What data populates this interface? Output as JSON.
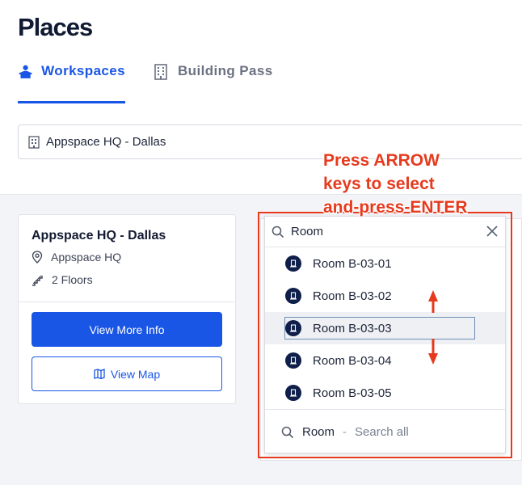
{
  "page": {
    "title": "Places"
  },
  "tabs": [
    {
      "label": "Workspaces",
      "icon": "person-desk-icon",
      "active": true
    },
    {
      "label": "Building Pass",
      "icon": "building-icon",
      "active": false
    }
  ],
  "location_select": {
    "value": "Appspace HQ - Dallas",
    "icon": "building-icon"
  },
  "card": {
    "title": "Appspace HQ - Dallas",
    "location": "Appspace HQ",
    "floors": "2 Floors",
    "primary_button": "View More Info",
    "secondary_button": "View Map"
  },
  "dropdown": {
    "search_value": "Room",
    "results": [
      "Room B-03-01",
      "Room B-03-02",
      "Room B-03-03",
      "Room B-03-04",
      "Room B-03-05"
    ],
    "active_result": "Room B-03-03",
    "search_all": {
      "query": "Room",
      "separator": "-",
      "label": "Search all"
    }
  },
  "annotation": {
    "lines": [
      "Press ARROW",
      "keys to select",
      "and-press-ENTER"
    ],
    "color": "#e63a1e"
  },
  "colors": {
    "accent": "#1a56e6",
    "room_icon": "#0f1f4a"
  }
}
